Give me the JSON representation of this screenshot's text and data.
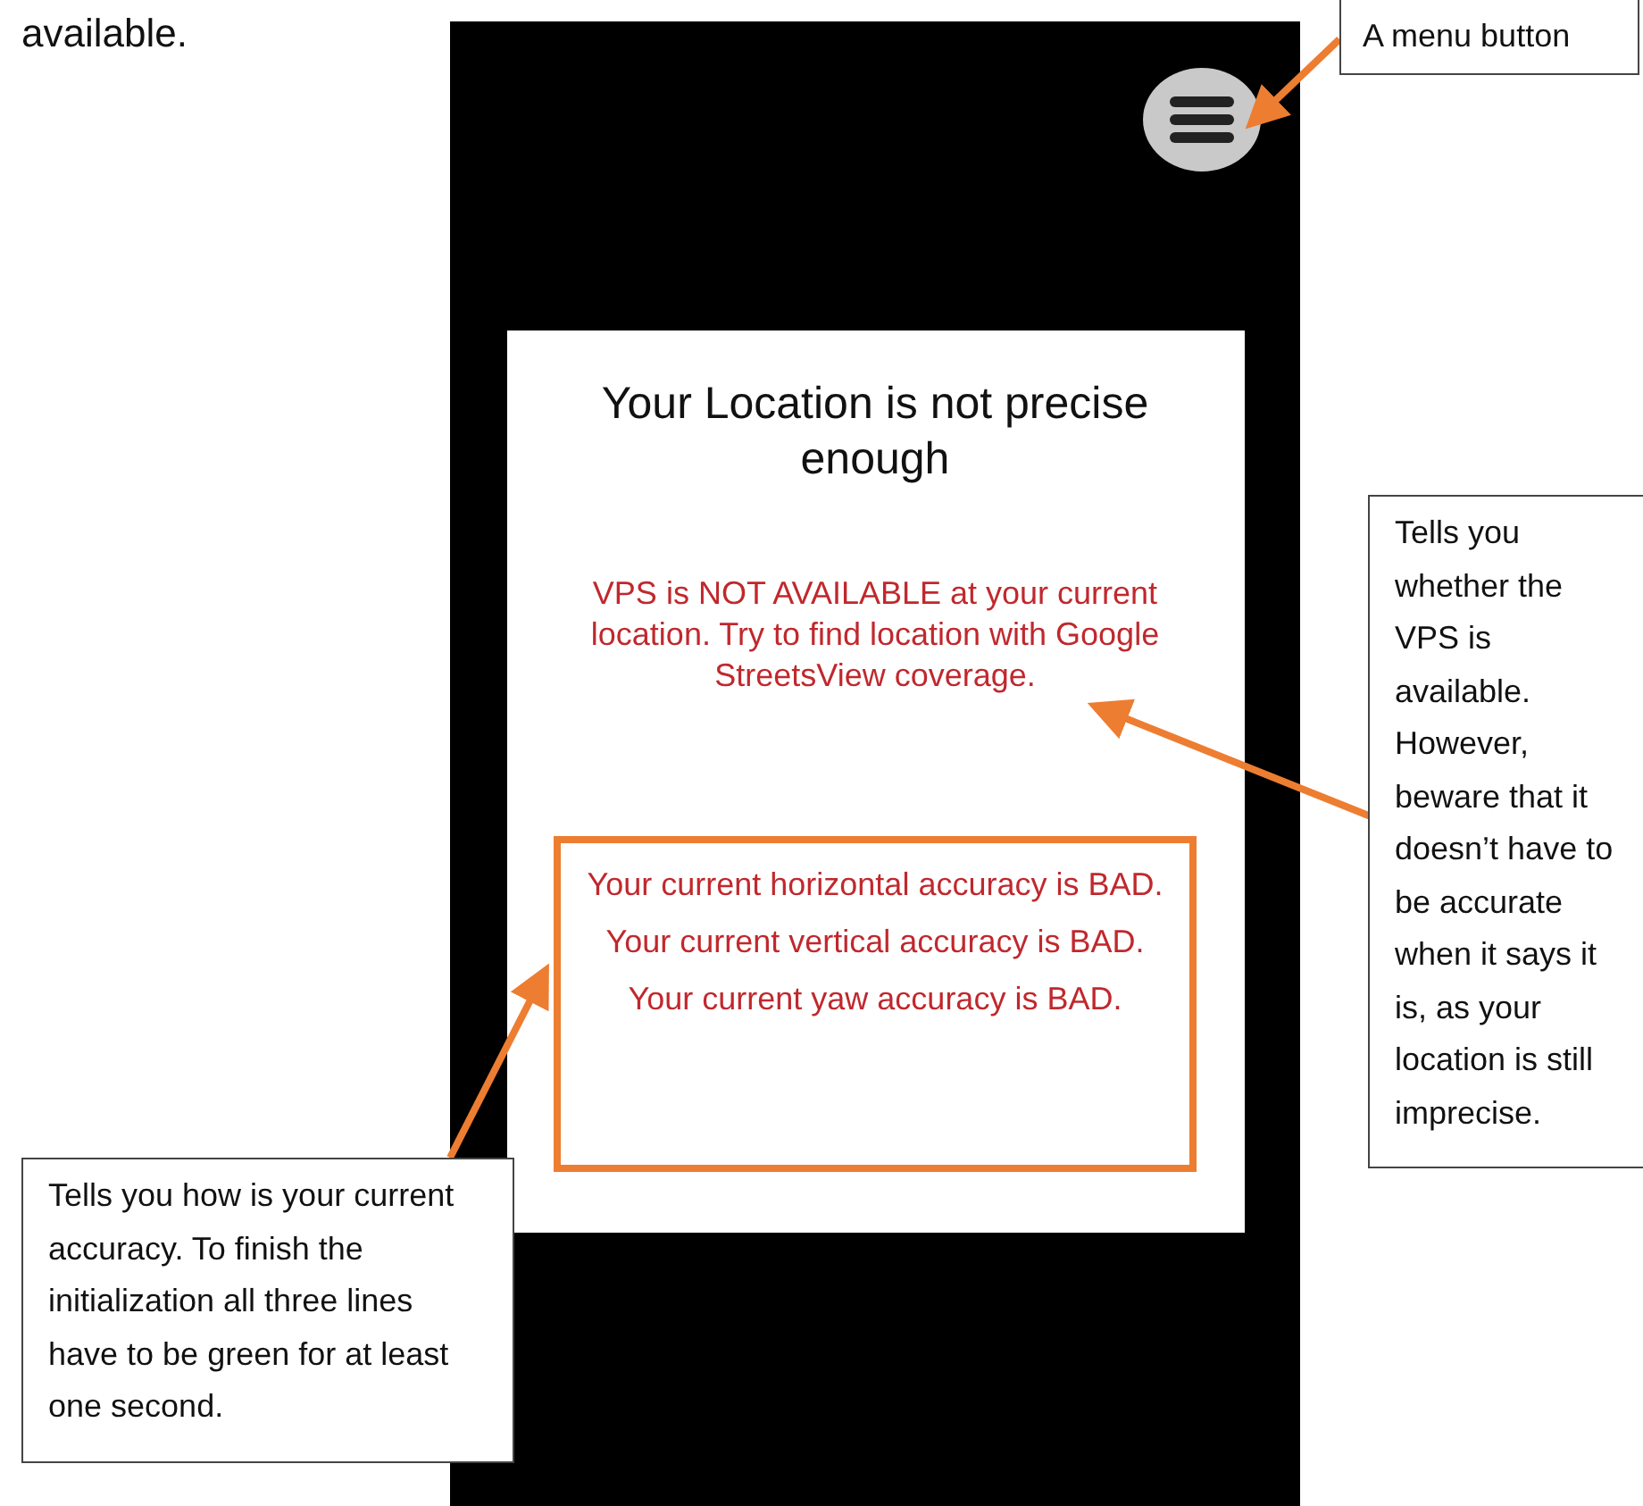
{
  "document_text": "available.",
  "phone": {
    "title": "Your Location is not precise enough",
    "vps_message": {
      "text": "VPS is NOT AVAILABLE at your current location. Try to find location with Google StreetsView coverage.",
      "available": false
    },
    "accuracy": [
      {
        "text": "Your current horizontal accuracy is BAD.",
        "good": false
      },
      {
        "text": "Your current vertical accuracy is BAD.",
        "good": false
      },
      {
        "text": "Your current yaw accuracy is BAD.",
        "good": false
      }
    ]
  },
  "annotations": [
    {
      "text": "A menu button"
    },
    {
      "text": "Tells you whether the VPS is available. However, beware that it doesn’t have to be accurate when it says it is, as your location is still imprecise."
    },
    {
      "text": "Tells you how is your current accuracy. To finish the initialization all three lines have to be green for at least one second."
    }
  ]
}
